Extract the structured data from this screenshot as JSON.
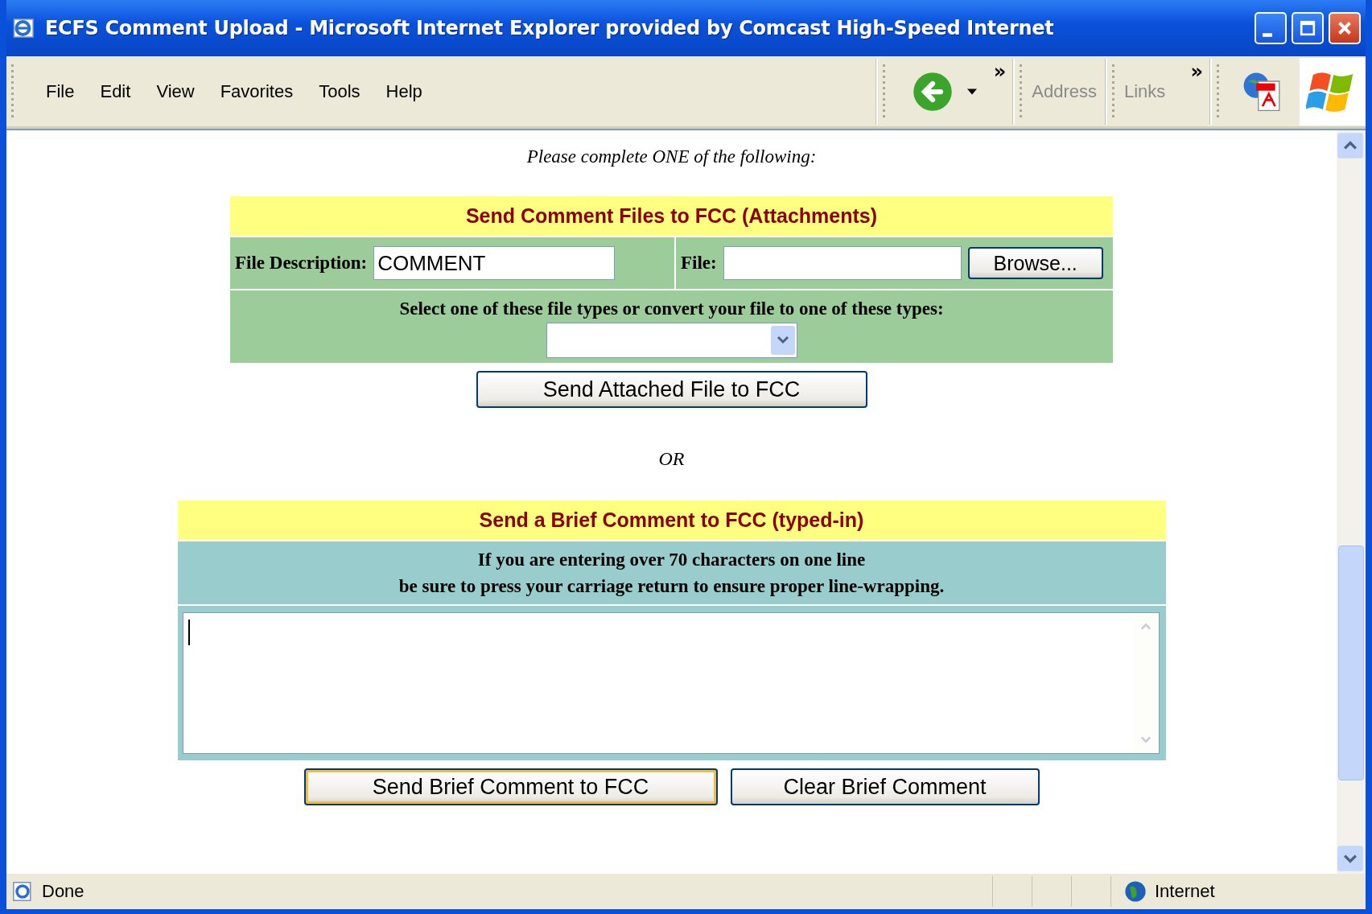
{
  "window": {
    "title": "ECFS Comment Upload - Microsoft Internet Explorer provided by Comcast High-Speed Internet"
  },
  "menu": [
    "File",
    "Edit",
    "View",
    "Favorites",
    "Tools",
    "Help"
  ],
  "toolbar": {
    "chevron_1": "»",
    "address_label": "Address",
    "links_label": "Links",
    "chevron_2": "»"
  },
  "page": {
    "intro": "Please complete ONE of the following:",
    "attachments": {
      "heading": "Send Comment Files to FCC (Attachments)",
      "description_label": "File Description:",
      "description_value": "COMMENT",
      "file_label": "File:",
      "browse_button": "Browse...",
      "types_label": "Select one of these file types or convert your file to one of these types:",
      "send_button": "Send Attached File to FCC"
    },
    "separator": "OR",
    "brief": {
      "heading": "Send a Brief Comment to FCC (typed-in)",
      "note_lines": [
        "If you are entering over 70 characters on one line",
        "be sure to press your carriage return to ensure proper line-wrapping."
      ],
      "buttons": [
        {
          "label": "Send Brief Comment to FCC",
          "focused": true
        },
        {
          "label": "Clear Brief Comment",
          "focused": false
        }
      ]
    }
  },
  "status_bar": {
    "text": "Done",
    "zone": "Internet"
  }
}
